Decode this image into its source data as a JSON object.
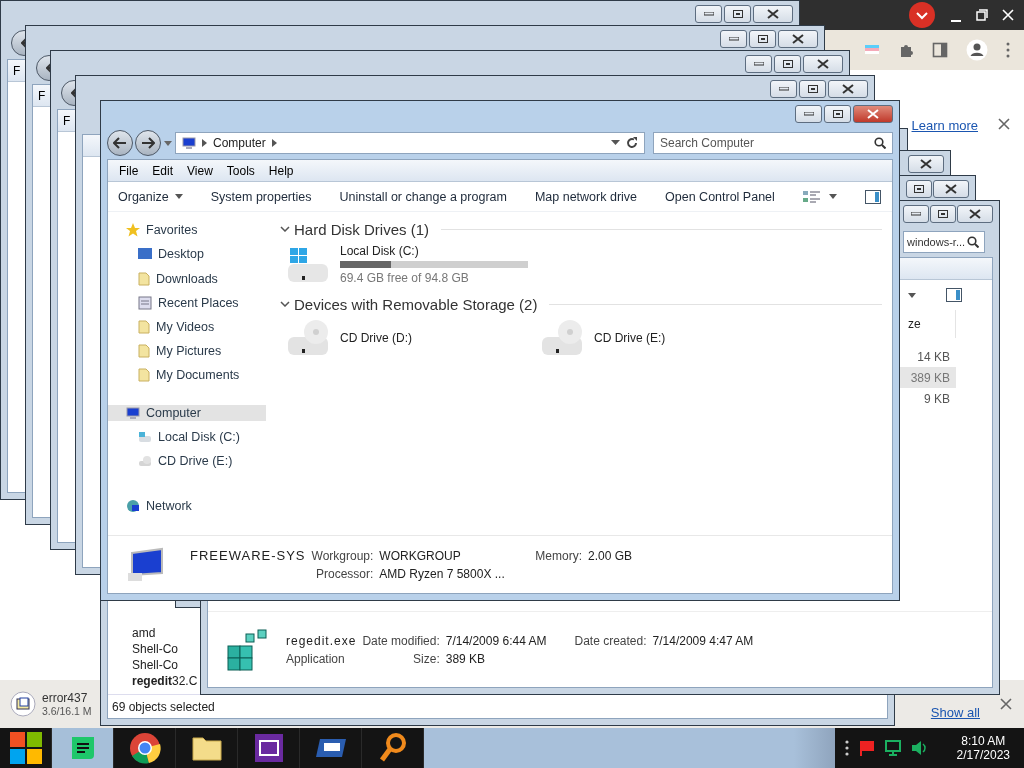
{
  "chrome": {
    "info_link": "Learn more",
    "downloads": [
      {
        "name": "error437",
        "progress": "3.6/16.1 M"
      }
    ],
    "show_all": "Show all"
  },
  "left_stack": [
    {
      "menu_letter": "F"
    },
    {
      "menu_letter": "F"
    },
    {
      "menu_letter": "F"
    }
  ],
  "status_window": {
    "files": [
      "amd",
      "Shell-Co",
      "Shell-Co",
      "**regedit**32.C"
    ],
    "status": "69 objects selected"
  },
  "details_window": {
    "search": "windows-r...",
    "column": "ze",
    "sizes": [
      {
        "text": "14 KB",
        "selected": false
      },
      {
        "text": "389 KB",
        "selected": true
      },
      {
        "text": "9 KB",
        "selected": false
      }
    ],
    "file": {
      "name": "regedit.exe",
      "type": "Application",
      "fields": [
        {
          "label": "Date modified:",
          "value": "7/14/2009 6:44 AM"
        },
        {
          "label": "Date created:",
          "value": "7/14/2009 4:47 AM"
        },
        {
          "label": "Size:",
          "value": "389 KB"
        }
      ]
    }
  },
  "main_window": {
    "address": [
      "Computer"
    ],
    "search": {
      "placeholder": "Search Computer"
    },
    "menu": [
      "File",
      "Edit",
      "View",
      "Tools",
      "Help"
    ],
    "commands": [
      {
        "label": "Organize",
        "kind": "dropdown"
      },
      {
        "label": "System properties",
        "kind": "plain"
      },
      {
        "label": "Uninstall or change a program",
        "kind": "plain"
      },
      {
        "label": "Map network drive",
        "kind": "plain"
      },
      {
        "label": "Open Control Panel",
        "kind": "plain"
      }
    ],
    "nav": [
      {
        "label": "Favorites",
        "kind": "star",
        "selected": false,
        "children": [
          {
            "label": "Desktop",
            "kind": "desktop",
            "selected": false
          },
          {
            "label": "Downloads",
            "kind": "folder",
            "selected": false
          },
          {
            "label": "Recent Places",
            "kind": "recent",
            "selected": false
          },
          {
            "label": "My Videos",
            "kind": "folder",
            "selected": false
          },
          {
            "label": "My Pictures",
            "kind": "folder",
            "selected": false
          },
          {
            "label": "My Documents",
            "kind": "folder",
            "selected": false
          }
        ]
      },
      {
        "label": "Computer",
        "kind": "computer",
        "selected": true,
        "children": [
          {
            "label": "Local Disk (C:)",
            "kind": "disk",
            "selected": false
          },
          {
            "label": "CD Drive (E:)",
            "kind": "cd",
            "selected": false
          }
        ]
      },
      {
        "label": "Network",
        "kind": "network",
        "selected": false
      }
    ],
    "groups": [
      {
        "title": "Hard Disk Drives (1)",
        "drives": [
          {
            "name": "Local Disk (C:)",
            "kind": "hdd",
            "level": 0.27,
            "free": "69.4 GB free of 94.8 GB"
          }
        ]
      },
      {
        "title": "Devices with Removable Storage (2)",
        "drives": [
          {
            "name": "CD Drive (D:)",
            "kind": "cd"
          },
          {
            "name": "CD Drive (E:)",
            "kind": "cd"
          }
        ]
      }
    ],
    "details": {
      "name": "FREEWARE-SYS",
      "fields": [
        {
          "label": "Workgroup:",
          "value": "WORKGROUP"
        },
        {
          "label": "Memory:",
          "value": "2.00 GB"
        },
        {
          "label": "Processor:",
          "value": "AMD Ryzen 7 5800X ..."
        }
      ]
    }
  },
  "taskbar": {
    "time": "8:10 AM",
    "date": "2/17/2023"
  }
}
